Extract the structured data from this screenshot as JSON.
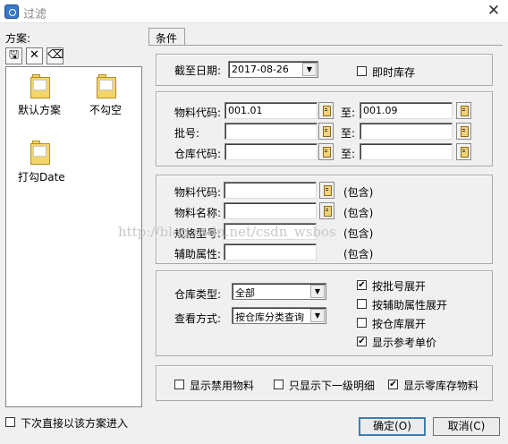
{
  "window": {
    "title": "过滤",
    "close_glyph": "✕"
  },
  "scheme_panel": {
    "label": "方案:",
    "toolbar": [
      {
        "name": "save-icon",
        "glyph": "🖫"
      },
      {
        "name": "delete-icon",
        "glyph": "✕"
      },
      {
        "name": "eraser-icon",
        "glyph": "⌫"
      }
    ],
    "items": [
      {
        "label": "默认方案"
      },
      {
        "label": "不勾空"
      },
      {
        "label": "打勾Date"
      }
    ]
  },
  "tab": {
    "label": "条件"
  },
  "date_group": {
    "label": "截至日期:",
    "value": "2017-08-26",
    "instant_stock_label": "即时库存",
    "instant_stock_checked": false
  },
  "code_group": {
    "material_code_label": "物料代码:",
    "material_code_from": "001.01",
    "material_code_to": "001.09",
    "to_label": "至:",
    "batch_label": "批号:",
    "batch_from": "",
    "batch_to": "",
    "warehouse_code_label": "仓库代码:",
    "warehouse_code_from": "",
    "warehouse_code_to": ""
  },
  "contains_group": {
    "contains_label": "(包含)",
    "material_code_label": "物料代码:",
    "material_name_label": "物料名称:",
    "spec_model_label": "规格型号:",
    "aux_attr_label": "辅助属性:"
  },
  "options_group": {
    "warehouse_type_label": "仓库类型:",
    "warehouse_type_value": "全部",
    "view_mode_label": "查看方式:",
    "view_mode_value": "按仓库分类查询",
    "checks": [
      {
        "label": "按批号展开",
        "checked": true
      },
      {
        "label": "按辅助属性展开",
        "checked": false
      },
      {
        "label": "按仓库展开",
        "checked": false
      },
      {
        "label": "显示参考单价",
        "checked": true
      }
    ]
  },
  "bottom_group": {
    "checks": [
      {
        "label": "显示禁用物料",
        "checked": false
      },
      {
        "label": "只显示下一级明细",
        "checked": false
      },
      {
        "label": "显示零库存物料",
        "checked": true
      }
    ]
  },
  "footer": {
    "direct_enter_label": "下次直接以该方案进入",
    "direct_enter_checked": false,
    "ok_label": "确定(O)",
    "cancel_label": "取消(C)"
  },
  "watermark": "http://blog.csdn.net/csdn_wsbos",
  "colors": {
    "accent": "#3c7fb1",
    "check": "#000000"
  }
}
